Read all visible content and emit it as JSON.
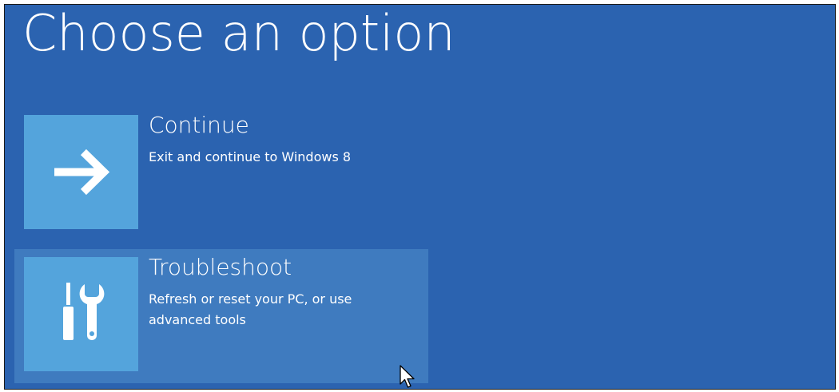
{
  "screen": {
    "title": "Choose an option",
    "background_color": "#2b63b0",
    "tile_color": "#54a4dc",
    "highlight_color": "#3f7bbf"
  },
  "options": [
    {
      "title": "Continue",
      "description": "Exit and continue to Windows 8",
      "icon": "arrow-right-icon",
      "selected": false
    },
    {
      "title": "Troubleshoot",
      "description": "Refresh or reset your PC, or use advanced tools",
      "icon": "screwdriver-wrench-icon",
      "selected": true
    }
  ],
  "cursor": {
    "icon": "mouse-pointer-icon"
  }
}
